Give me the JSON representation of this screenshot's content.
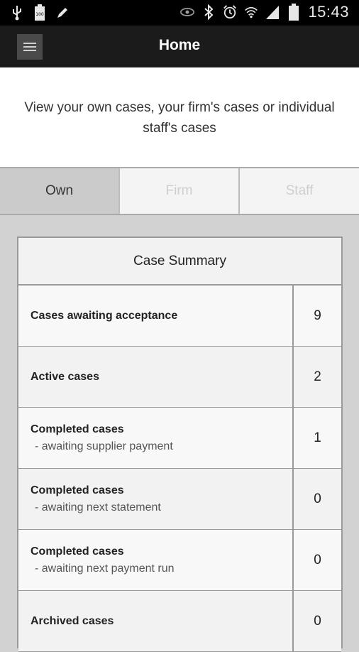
{
  "status_bar": {
    "time": "15:43",
    "battery_label": "100",
    "icons": [
      "usb-icon",
      "battery-icon",
      "pencil-icon",
      "eye-icon",
      "bluetooth-icon",
      "alarm-icon",
      "wifi-icon",
      "signal-icon",
      "battery-full-icon"
    ]
  },
  "action_bar": {
    "title": "Home",
    "menu_icon": "hamburger-menu-icon"
  },
  "intro": {
    "text": "View your own cases, your firm's cases or individual staff's cases"
  },
  "tabs": [
    {
      "label": "Own",
      "selected": true
    },
    {
      "label": "Firm",
      "selected": false
    },
    {
      "label": "Staff",
      "selected": false
    }
  ],
  "summary": {
    "header": "Case Summary",
    "rows": [
      {
        "label": "Cases awaiting acceptance",
        "sub": "",
        "value": "9"
      },
      {
        "label": "Active cases",
        "sub": "",
        "value": "2"
      },
      {
        "label": "Completed cases",
        "sub": "- awaiting supplier payment",
        "value": "1"
      },
      {
        "label": "Completed cases",
        "sub": "- awaiting next statement",
        "value": "0"
      },
      {
        "label": "Completed cases",
        "sub": "- awaiting next payment run",
        "value": "0"
      },
      {
        "label": "Archived cases",
        "sub": "",
        "value": "0"
      }
    ]
  }
}
